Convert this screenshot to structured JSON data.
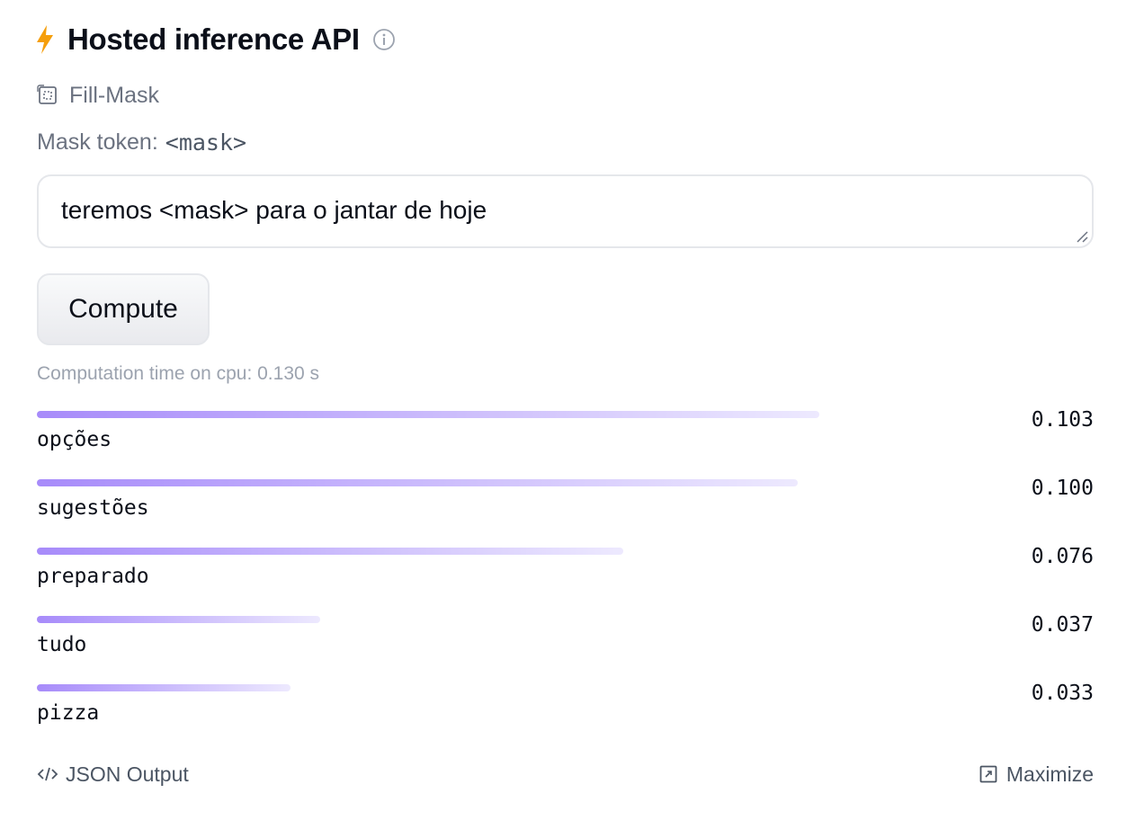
{
  "header": {
    "title": "Hosted inference API",
    "bolt_icon": "lightning-bolt-icon",
    "info_icon": "info-icon",
    "accent_color": "#f59e0b"
  },
  "task": {
    "label": "Fill-Mask",
    "icon": "fill-mask-icon"
  },
  "mask": {
    "label": "Mask token:",
    "token": "<mask>"
  },
  "input": {
    "value": "teremos <mask> para o jantar de hoje"
  },
  "compute": {
    "label": "Compute"
  },
  "computation_time": "Computation time on cpu: 0.130 s",
  "results": [
    {
      "label": "opções",
      "score": "0.103",
      "bar_fraction": 0.74
    },
    {
      "label": "sugestões",
      "score": "0.100",
      "bar_fraction": 0.72
    },
    {
      "label": "preparado",
      "score": "0.076",
      "bar_fraction": 0.555
    },
    {
      "label": "tudo",
      "score": "0.037",
      "bar_fraction": 0.268
    },
    {
      "label": "pizza",
      "score": "0.033",
      "bar_fraction": 0.24
    }
  ],
  "footer": {
    "json_output_label": "JSON Output",
    "maximize_label": "Maximize"
  },
  "colors": {
    "bar_start": "#a78bfa",
    "bar_end": "#ede9fe"
  }
}
